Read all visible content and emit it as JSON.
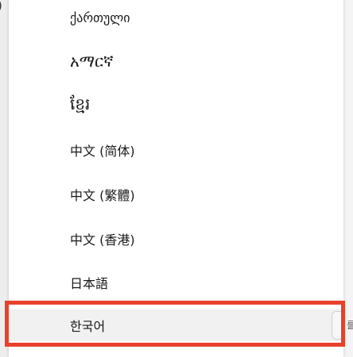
{
  "languages": [
    {
      "label": "ქართული"
    },
    {
      "label": "አማርኛ"
    },
    {
      "label": "ខ្មែរ"
    },
    {
      "label": "中文 (简体)"
    },
    {
      "label": "中文 (繁體)"
    },
    {
      "label": "中文 (香港)"
    },
    {
      "label": "日本語"
    },
    {
      "label": "한국어",
      "selected": true
    }
  ],
  "edge": {
    "left_glyph": ")",
    "right_glyph": "를"
  },
  "colors": {
    "highlight": "#e8412c"
  }
}
